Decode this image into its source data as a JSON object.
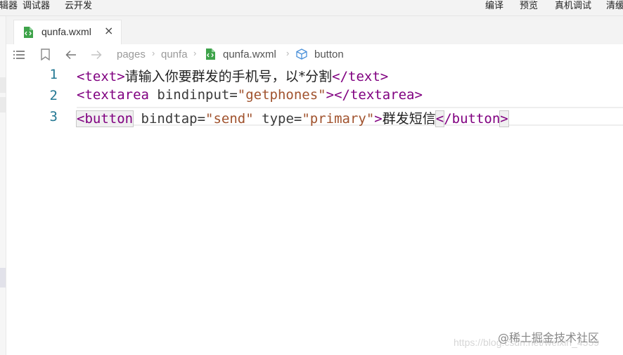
{
  "toolbar": {
    "left_items": [
      "编辑器",
      "调试器",
      "云开发"
    ],
    "right_items": [
      "编译",
      "预览",
      "真机调试",
      "清缓存"
    ]
  },
  "tab": {
    "title": "qunfa.wxml",
    "close": "×",
    "file_icon": "wxml-file-icon"
  },
  "breadcrumb": [
    "pages",
    "qunfa",
    "qunfa.wxml",
    "button"
  ],
  "code_lines": [
    {
      "number": "1",
      "text": "<text>请输入你要群发的手机号，以*分割</text>"
    },
    {
      "number": "2",
      "text": "<textarea bindinput=\"getphones\"></textarea>"
    },
    {
      "number": "3",
      "text": "<button bindtap=\"send\" type=\"primary\">群发短信</button>"
    }
  ],
  "code_tokens": {
    "l1_open": "<text>",
    "l1_text": "请输入你要群发的手机号，以*分割",
    "l1_close": "</text>",
    "l2_open": "<textarea",
    "l2_attr": " bindinput",
    "l2_eq": "=",
    "l2_val": "\"getphones\"",
    "l2_end": "></textarea>",
    "l3_open": "<button",
    "l3_attr1": " bindtap",
    "l3_eq1": "=",
    "l3_val1": "\"send\"",
    "l3_attr2": " type",
    "l3_eq2": "=",
    "l3_val2": "\"primary\"",
    "l3_gt": ">",
    "l3_text": "群发短信",
    "l3_close_lt": "<",
    "l3_close_name": "/button",
    "l3_close_gt": ">"
  },
  "watermark": {
    "brand": "@稀土掘金技术社区",
    "url": "https://blog.csdn.net/weixin_4559"
  },
  "colors": {
    "tag": "#800080",
    "string": "#a0522d",
    "line_number": "#237893"
  }
}
